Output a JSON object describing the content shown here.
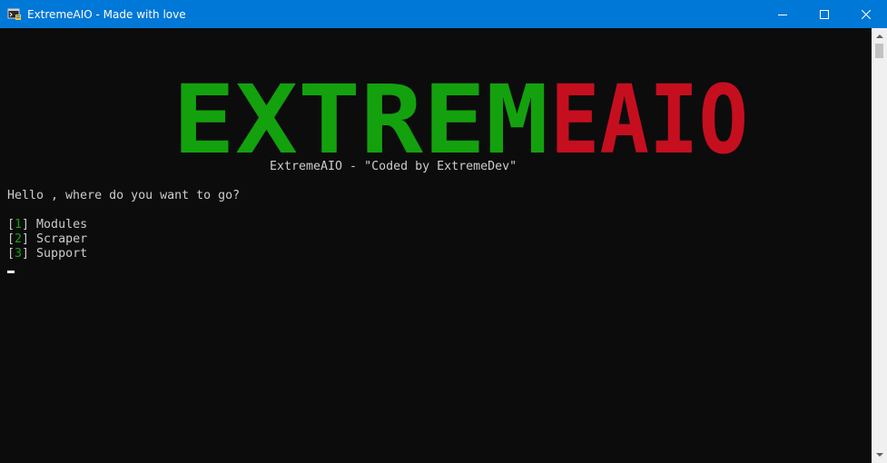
{
  "window": {
    "title": "ExtremeAIO - Made with love"
  },
  "colors": {
    "titlebar": "#0078d7",
    "console_bg": "#0c0c0c",
    "text": "#cccccc",
    "accent_green": "#13a10e",
    "accent_red": "#c50f1f"
  },
  "banner": {
    "green_part": "EXTREM",
    "red_part": "EAIO"
  },
  "console": {
    "subtitle": "ExtremeAIO - \"Coded by ExtremeDev\"",
    "prompt": "Hello , where do you want to go?",
    "options": [
      {
        "num": "1",
        "label": "Modules"
      },
      {
        "num": "2",
        "label": "Scraper"
      },
      {
        "num": "3",
        "label": "Support"
      }
    ]
  },
  "icons": {
    "app": "console-app-icon",
    "minimize": "minimize-icon",
    "maximize": "maximize-icon",
    "close": "close-icon"
  }
}
